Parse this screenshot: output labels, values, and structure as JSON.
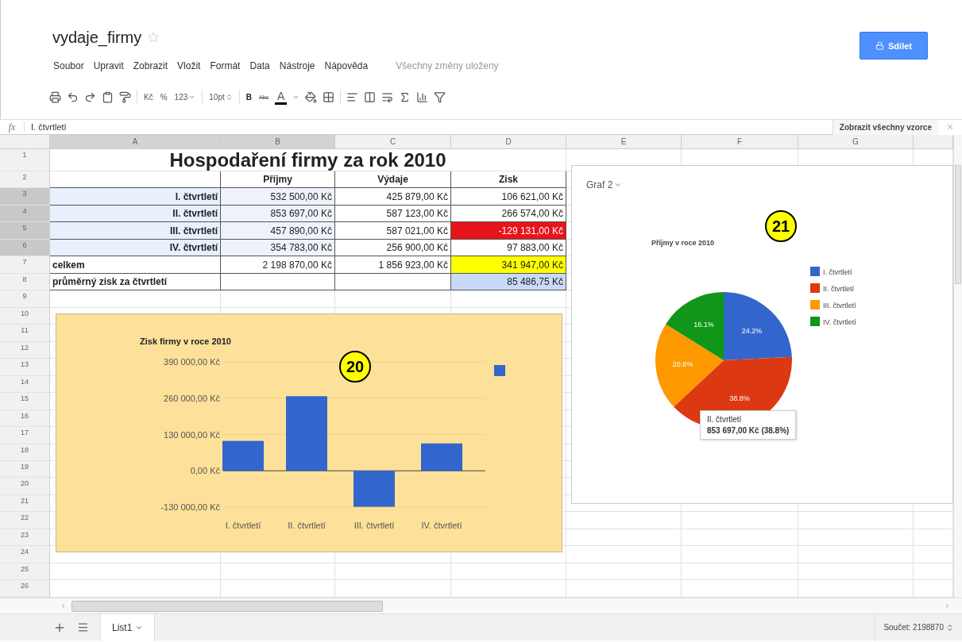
{
  "document": {
    "title": "vydaje_firmy",
    "starred": false,
    "share_button": "Sdílet"
  },
  "menu": [
    "Soubor",
    "Upravit",
    "Zobrazit",
    "Vložit",
    "Formát",
    "Data",
    "Nástroje",
    "Nápověda"
  ],
  "save_status": "Všechny změny uloženy",
  "toolbar": {
    "currency": "Kč",
    "percent": "%",
    "number_format": "123",
    "font_size": "10pt",
    "bold": "B",
    "strikethrough": "Abc",
    "text_color": "A"
  },
  "formula_bar": {
    "icon": "fx",
    "value": "I. čtvrtletí",
    "show_formulas_button": "Zobrazit všechny vzorce",
    "close": "×"
  },
  "columns": [
    {
      "label": "A",
      "selected": true
    },
    {
      "label": "B",
      "selected": true
    },
    {
      "label": "C",
      "selected": false
    },
    {
      "label": "D",
      "selected": false
    },
    {
      "label": "E",
      "selected": false
    },
    {
      "label": "F",
      "selected": false
    },
    {
      "label": "G",
      "selected": false
    }
  ],
  "rows": [
    {
      "number": "1",
      "selected": false,
      "kind": "title",
      "cells": [
        {
          "text": "Hospodaření firmy za rok 2010"
        }
      ]
    },
    {
      "number": "2",
      "selected": false,
      "kind": "header",
      "cells": [
        {},
        {
          "text": "Příjmy"
        },
        {
          "text": "Výdaje"
        },
        {
          "text": "Zisk"
        }
      ]
    },
    {
      "number": "3",
      "selected": true,
      "kind": "quarter",
      "cells": [
        {
          "text": "I. čtvrtletí",
          "color": "#e8f0fe"
        },
        {
          "text": "532 500,00 Kč",
          "color": "#eef3fb"
        },
        {
          "text": "425 879,00 Kč"
        },
        {
          "text": "106 621,00 Kč"
        }
      ]
    },
    {
      "number": "4",
      "selected": true,
      "kind": "quarter",
      "cells": [
        {
          "text": "II. čtvrtletí",
          "color": "#e8f0fe"
        },
        {
          "text": "853 697,00 Kč",
          "color": "#eef3fb"
        },
        {
          "text": "587 123,00 Kč"
        },
        {
          "text": "266 574,00 Kč"
        }
      ]
    },
    {
      "number": "5",
      "selected": true,
      "kind": "quarter",
      "cells": [
        {
          "text": "III. čtvrtletí",
          "color": "#e8f0fe"
        },
        {
          "text": "457 890,00 Kč",
          "color": "#eef3fb"
        },
        {
          "text": "587 021,00 Kč"
        },
        {
          "text": "-129 131,00 Kč",
          "color": "#e8141b"
        }
      ]
    },
    {
      "number": "6",
      "selected": true,
      "kind": "quarter",
      "cells": [
        {
          "text": "IV. čtvrtletí",
          "color": "#e8f0fe"
        },
        {
          "text": "354 783,00 Kč",
          "color": "#eef3fb"
        },
        {
          "text": "256 900,00 Kč"
        },
        {
          "text": "97 883,00 Kč"
        }
      ]
    },
    {
      "number": "7",
      "selected": false,
      "kind": "total",
      "cells": [
        {
          "text": "celkem"
        },
        {
          "text": "2 198 870,00 Kč"
        },
        {
          "text": "1 856 923,00 Kč"
        },
        {
          "text": "341 947,00 Kč",
          "color": "#ffff00"
        }
      ]
    },
    {
      "number": "8",
      "selected": false,
      "kind": "total",
      "cells": [
        {
          "text": "průměrný zisk za čtvrtletí"
        },
        {},
        {},
        {
          "text": "85 486,75 Kč",
          "color": "#c9daf8"
        }
      ]
    },
    {
      "number": "9",
      "selected": false
    },
    {
      "number": "10",
      "selected": false
    },
    {
      "number": "11",
      "selected": false
    },
    {
      "number": "12",
      "selected": false
    },
    {
      "number": "13",
      "selected": false
    },
    {
      "number": "14",
      "selected": false
    },
    {
      "number": "15",
      "selected": false
    },
    {
      "number": "16",
      "selected": false
    },
    {
      "number": "17",
      "selected": false
    },
    {
      "number": "18",
      "selected": false
    },
    {
      "number": "19",
      "selected": false
    },
    {
      "number": "20",
      "selected": false
    },
    {
      "number": "21",
      "selected": false
    },
    {
      "number": "22",
      "selected": false
    },
    {
      "number": "23",
      "selected": false
    },
    {
      "number": "24",
      "selected": false
    },
    {
      "number": "25",
      "selected": false
    },
    {
      "number": "26",
      "selected": false
    }
  ],
  "bar_chart": {
    "callout": "20",
    "chart_data": {
      "type": "bar",
      "title": "Zisk firmy v roce 2010",
      "categories": [
        "I. čtvrtletí",
        "II. čtvrtletí",
        "III. čtvrtletí",
        "IV. čtvrtletí"
      ],
      "series": [
        {
          "color": "#3366cc",
          "values": [
            107000,
            267000,
            -129000,
            98000
          ]
        }
      ],
      "ylim": [
        -130000,
        390000
      ],
      "yticks": [
        {
          "value": -130000,
          "label": "-130 000,00 Kč"
        },
        {
          "value": 0,
          "label": "0,00 Kč"
        },
        {
          "value": 130000,
          "label": "130 000,00 Kč"
        },
        {
          "value": 260000,
          "label": "260 000,00 Kč"
        },
        {
          "value": 390000,
          "label": "390 000,00 Kč"
        }
      ]
    }
  },
  "pie_chart": {
    "menu_label": "Graf 2",
    "callout": "21",
    "chart_data": {
      "type": "pie",
      "title": "Příjmy v roce 2010",
      "categories": [
        "I. čtvrtletí",
        "II. čtvrtletí",
        "III. čtvrtletí",
        "IV. čtvrtletí"
      ],
      "values": [
        24.2,
        38.8,
        20.8,
        16.1
      ],
      "colors": [
        "#3366cc",
        "#dc3912",
        "#ff9900",
        "#109618"
      ],
      "legend": "right",
      "value_labels": [
        "24.2%",
        "38.8%",
        "20.8%",
        "16.1%"
      ]
    },
    "tooltip": {
      "title": "II. čtvrtletí",
      "value": "853 697,00 Kč (38.8%)"
    }
  },
  "sheet_tabs": [
    {
      "label": "List1",
      "selected": true
    }
  ],
  "status": "Součet: 2198870"
}
